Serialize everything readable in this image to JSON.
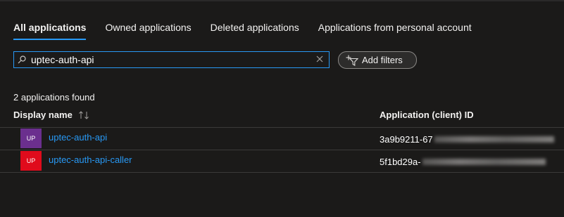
{
  "tabs": [
    {
      "label": "All applications",
      "active": true
    },
    {
      "label": "Owned applications",
      "active": false
    },
    {
      "label": "Deleted applications",
      "active": false
    },
    {
      "label": "Applications from personal account",
      "active": false
    }
  ],
  "search": {
    "value": "uptec-auth-api"
  },
  "filters": {
    "add_label": "Add filters"
  },
  "results": {
    "count_text": "2 applications found"
  },
  "table": {
    "columns": {
      "display_name": "Display name",
      "client_id": "Application (client) ID"
    },
    "rows": [
      {
        "avatar": "UP",
        "avatar_color": "#6b2f8e",
        "name": "uptec-auth-api",
        "client_id_visible": "3a9b9211-67"
      },
      {
        "avatar": "UP",
        "avatar_color": "#e00b1c",
        "name": "uptec-auth-api-caller",
        "client_id_visible": "5f1bd29a-"
      }
    ]
  },
  "colors": {
    "accent": "#2899f5",
    "background": "#1b1a19"
  }
}
